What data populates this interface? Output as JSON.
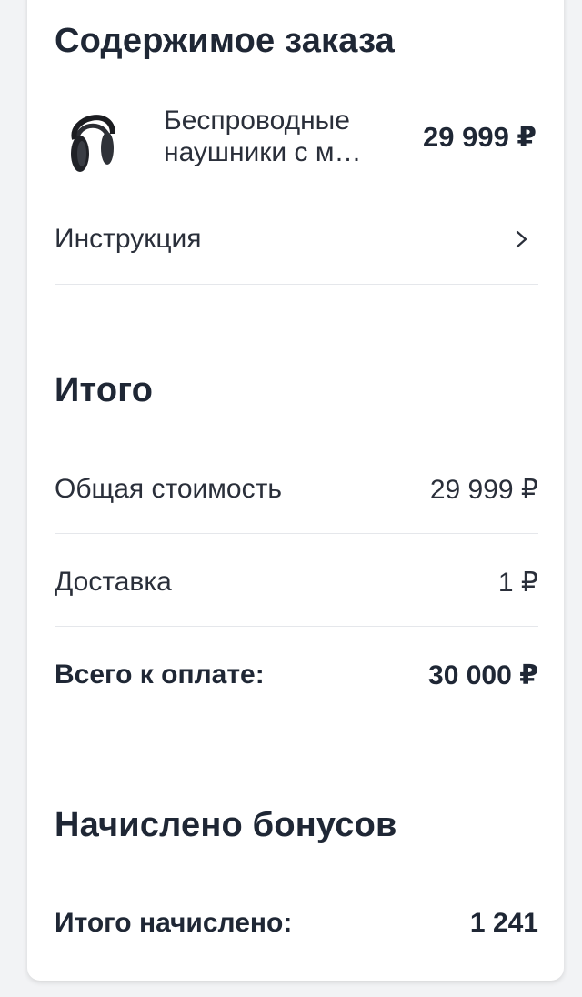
{
  "order": {
    "title": "Содержимое заказа",
    "product": {
      "name": "Беспроводные наушники с м…",
      "price": "29 999 ₽",
      "image_icon": "headphones-icon"
    },
    "instruction_label": "Инструкция"
  },
  "summary": {
    "title": "Итого",
    "rows": [
      {
        "label": "Общая стоимость",
        "value": "29 999 ₽"
      },
      {
        "label": "Доставка",
        "value": "1 ₽"
      },
      {
        "label": "Всего к оплате:",
        "value": "30 000 ₽"
      }
    ]
  },
  "bonuses": {
    "title": "Начислено бонусов",
    "total_label": "Итого начислено:",
    "total_value": "1 241"
  },
  "colors": {
    "text_primary": "#1f2735",
    "divider": "#e5e7eb",
    "background": "#f2f3f5",
    "card": "#ffffff"
  }
}
